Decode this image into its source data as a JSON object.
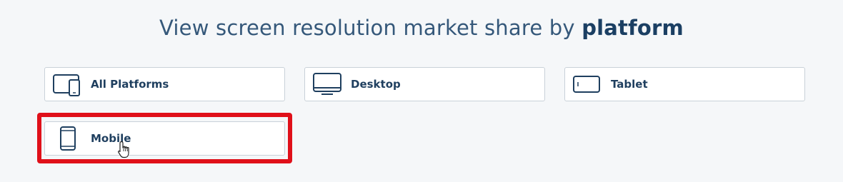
{
  "heading": {
    "prefix": "View screen resolution market share by ",
    "emphasis": "platform"
  },
  "platforms": [
    {
      "label": "All Platforms",
      "icon": "all-platforms-icon"
    },
    {
      "label": "Desktop",
      "icon": "desktop-icon"
    },
    {
      "label": "Tablet",
      "icon": "tablet-icon"
    },
    {
      "label": "Mobile",
      "icon": "mobile-icon"
    }
  ],
  "selected": "Mobile",
  "colors": {
    "accent": "#1f3f5f",
    "highlight": "#e0101a",
    "background": "#f5f7f9"
  }
}
